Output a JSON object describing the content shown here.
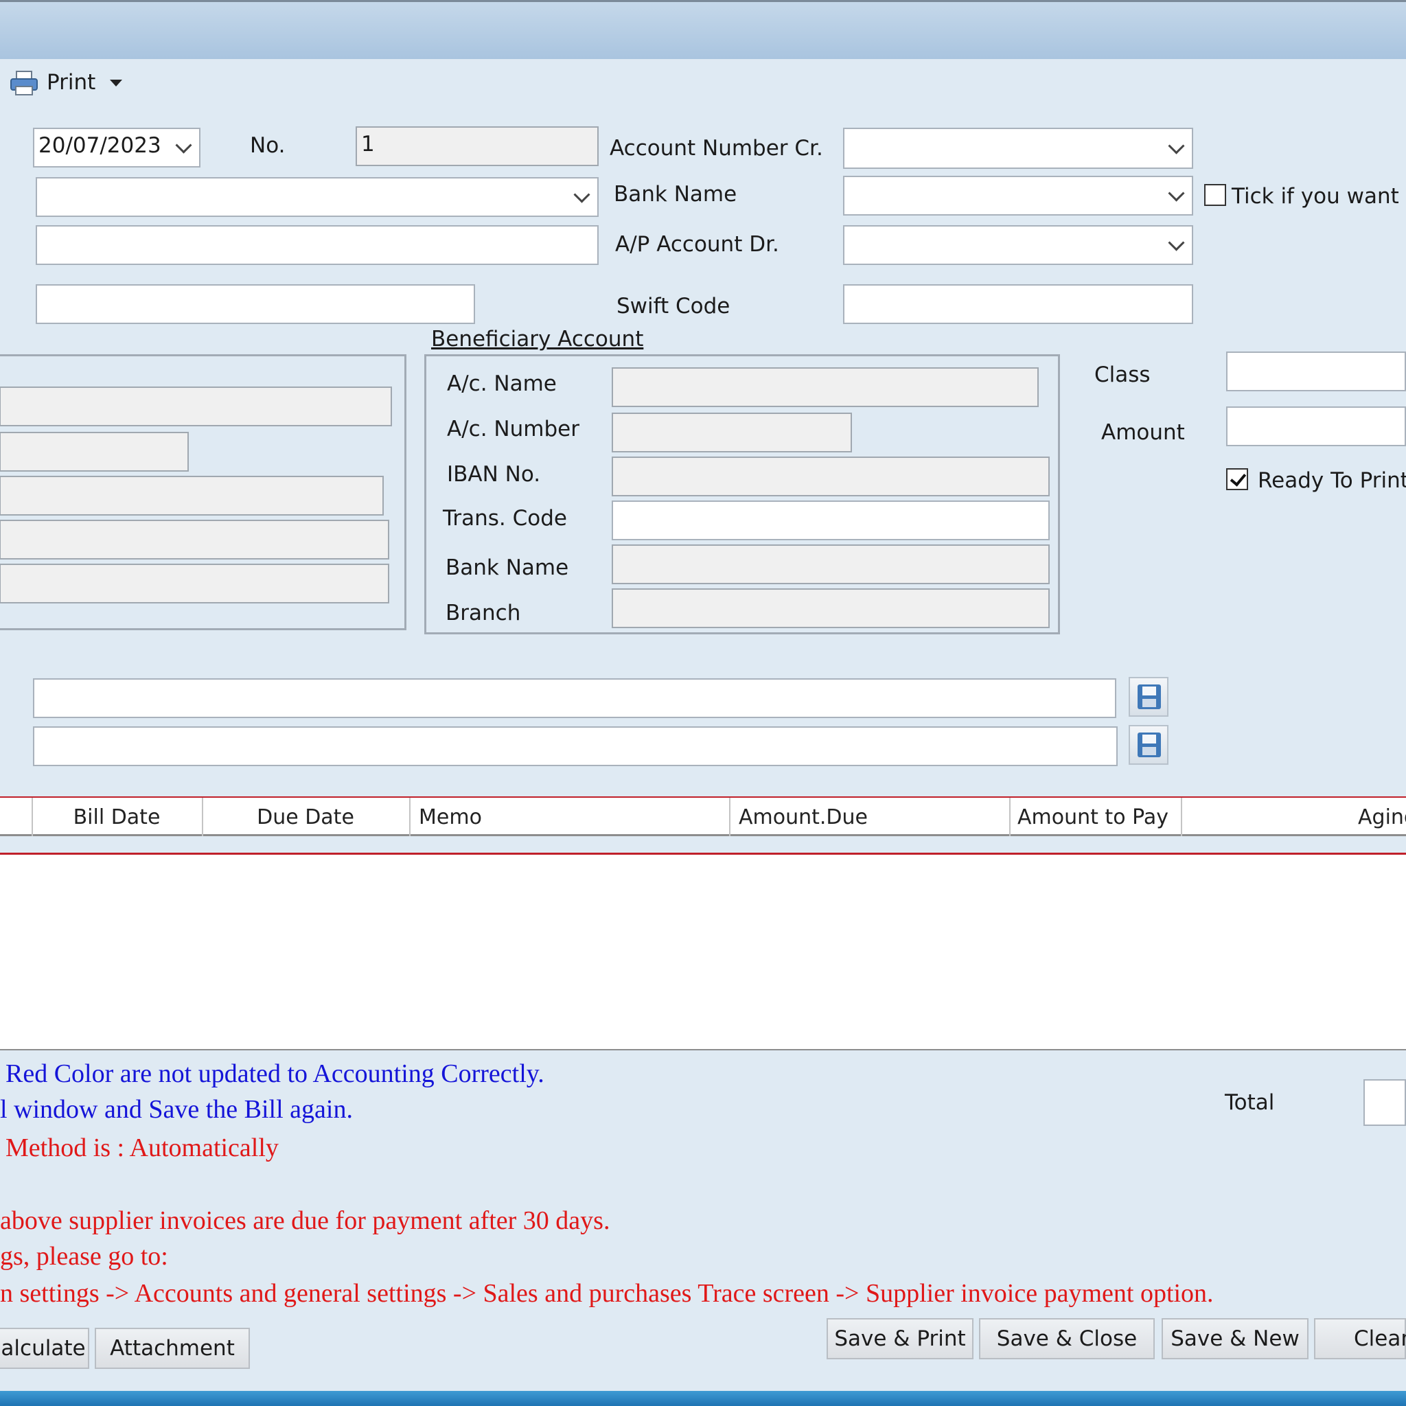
{
  "toolbar": {
    "print_label": "Print"
  },
  "form": {
    "date_value": "20/07/2023",
    "no_label": "No.",
    "no_value": "1",
    "account_number_cr_label": "Account Number Cr.",
    "bank_name_label": "Bank Name",
    "ap_account_dr_label": "A/P Account Dr.",
    "swift_code_label": "Swift Code",
    "tick_label": "Tick if you want Ba",
    "class_label": "Class",
    "amount_label": "Amount",
    "ready_to_print_label": "Ready To Print",
    "ready_to_print_checked": true,
    "tick_checked": false
  },
  "beneficiary": {
    "title": "Beneficiary Account",
    "ac_name_label": "A/c. Name",
    "ac_number_label": "A/c. Number",
    "iban_label": "IBAN No.",
    "trans_code_label": "Trans. Code",
    "bank_name_label": "Bank Name",
    "branch_label": "Branch"
  },
  "grid": {
    "columns": [
      "Bill Date",
      "Due Date",
      "Memo",
      "Amount.Due",
      "Amount to Pay",
      "Aging"
    ]
  },
  "notes": {
    "line1": "Red Color are not updated to Accounting Correctly.",
    "line2": "l window and Save the Bill again.",
    "line3": "Method is : Automatically",
    "line4": "above supplier invoices are due for payment after 30 days.",
    "line5": "gs, please go to:",
    "line6": "n settings -> Accounts and general settings  -> Sales and purchases Trace screen -> Supplier invoice payment option."
  },
  "total": {
    "label": "Total"
  },
  "buttons": {
    "calculate": "alculate",
    "attachment": "Attachment",
    "save_print": "Save & Print",
    "save_close": "Save & Close",
    "save_new": "Save & New",
    "clear": "Clear"
  },
  "colors": {
    "note_blue": "#1414d8",
    "note_red": "#e01818",
    "grid_rule_red": "#c0202a"
  },
  "icons": {
    "printer": "printer-icon",
    "dropdown": "chevron-down-icon",
    "save": "floppy-disk-icon"
  }
}
